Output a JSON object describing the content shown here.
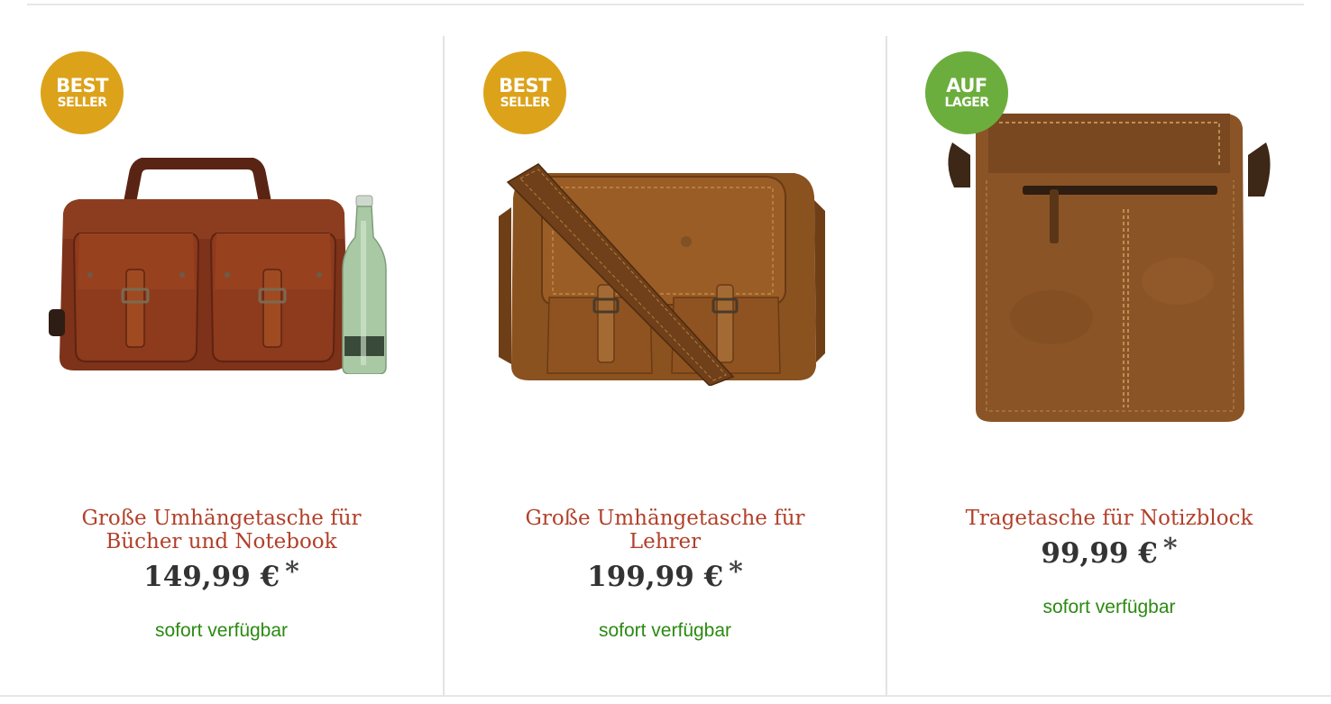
{
  "colors": {
    "title": "#b2402a",
    "price": "#333333",
    "availability": "#2b8a12",
    "badge_bestseller": "#dca21a",
    "badge_instock": "#6cae3d",
    "divider": "#e3e3e3"
  },
  "products": [
    {
      "badge": {
        "line1": "BEST",
        "line2": "SELLER",
        "style": "gold"
      },
      "title_line1": "Große Umhängetasche für",
      "title_line2": "Bücher und Notebook",
      "price": "149,99 €",
      "price_marker": "*",
      "availability": "sofort verfügbar",
      "image": "brown leather briefcase with two front pockets next to water bottle"
    },
    {
      "badge": {
        "line1": "BEST",
        "line2": "SELLER",
        "style": "gold"
      },
      "title_line1": "Große Umhängetasche für",
      "title_line2": "Lehrer",
      "price": "199,99 €",
      "price_marker": "*",
      "availability": "sofort verfügbar",
      "image": "tan leather messenger bag with shoulder strap"
    },
    {
      "badge": {
        "line1": "AUF",
        "line2": "LAGER",
        "style": "green"
      },
      "title_line1": "Tragetasche für Notizblock",
      "title_line2": "",
      "price": "99,99 €",
      "price_marker": "*",
      "availability": "sofort verfügbar",
      "image": "upright brown leather shoulder bag with zip pocket"
    }
  ]
}
